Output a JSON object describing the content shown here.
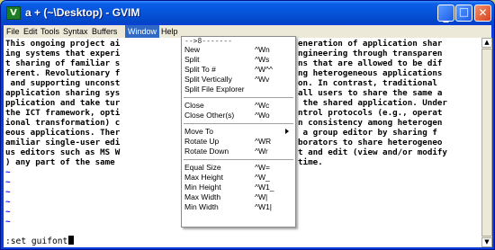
{
  "window": {
    "title": "a + (~\\Desktop) - GVIM",
    "app_icon": "V",
    "controls": {
      "minimize": "_",
      "maximize": "□",
      "close": "✕"
    }
  },
  "menubar": [
    "File",
    "Edit",
    "Tools",
    "Syntax",
    "Buffers",
    "Window",
    "Help"
  ],
  "active_menu": "Window",
  "editor": {
    "lines": [
      "This ongoing project ai",
      "ing systems that experi",
      "t sharing of familiar s",
      "ferent. Revolutionary f",
      " and supporting unconst",
      "application sharing sys",
      "pplication and take tur",
      "the ICT framework, opti",
      "ional transformation) c",
      "eous applications. Ther",
      "amiliar single-user edi",
      "us editors such as MS W",
      ") any part of the same "
    ],
    "right_lines": [
      "eneration of application shar",
      "ngineering through transparen",
      "ns that are allowed to be dif",
      "ng heterogeneous applications",
      "on. In contrast, traditional ",
      "all users to share the same a",
      " the shared application. Under",
      "ntrol protocols (e.g., operat",
      "n consistency among heterogen",
      " a group editor by sharing f",
      "borators to share heterogeneo",
      "t and edit (view and/or modify",
      "time."
    ],
    "tilde": "~",
    "command_line": ":set guifont"
  },
  "window_menu": {
    "tearoff": "-->8-------",
    "items": [
      {
        "label": "New",
        "accel": "^Wn"
      },
      {
        "label": "Split",
        "accel": "^Ws"
      },
      {
        "label": "Split To #",
        "accel": "^W^^"
      },
      {
        "label": "Split Vertically",
        "accel": "^Wv"
      },
      {
        "label": "Split File Explorer",
        "accel": ""
      },
      {
        "label": "Close",
        "accel": "^Wc"
      },
      {
        "label": "Close Other(s)",
        "accel": "^Wo"
      },
      {
        "label": "Move To",
        "accel": ""
      },
      {
        "label": "Rotate Up",
        "accel": "^WR"
      },
      {
        "label": "Rotate Down",
        "accel": "^Wr"
      },
      {
        "label": "Equal Size",
        "accel": "^W="
      },
      {
        "label": "Max Height",
        "accel": "^W_"
      },
      {
        "label": "Min Height",
        "accel": "^W1_"
      },
      {
        "label": "Max Width",
        "accel": "^W|"
      },
      {
        "label": "Min Width",
        "accel": "^W1|"
      }
    ]
  }
}
